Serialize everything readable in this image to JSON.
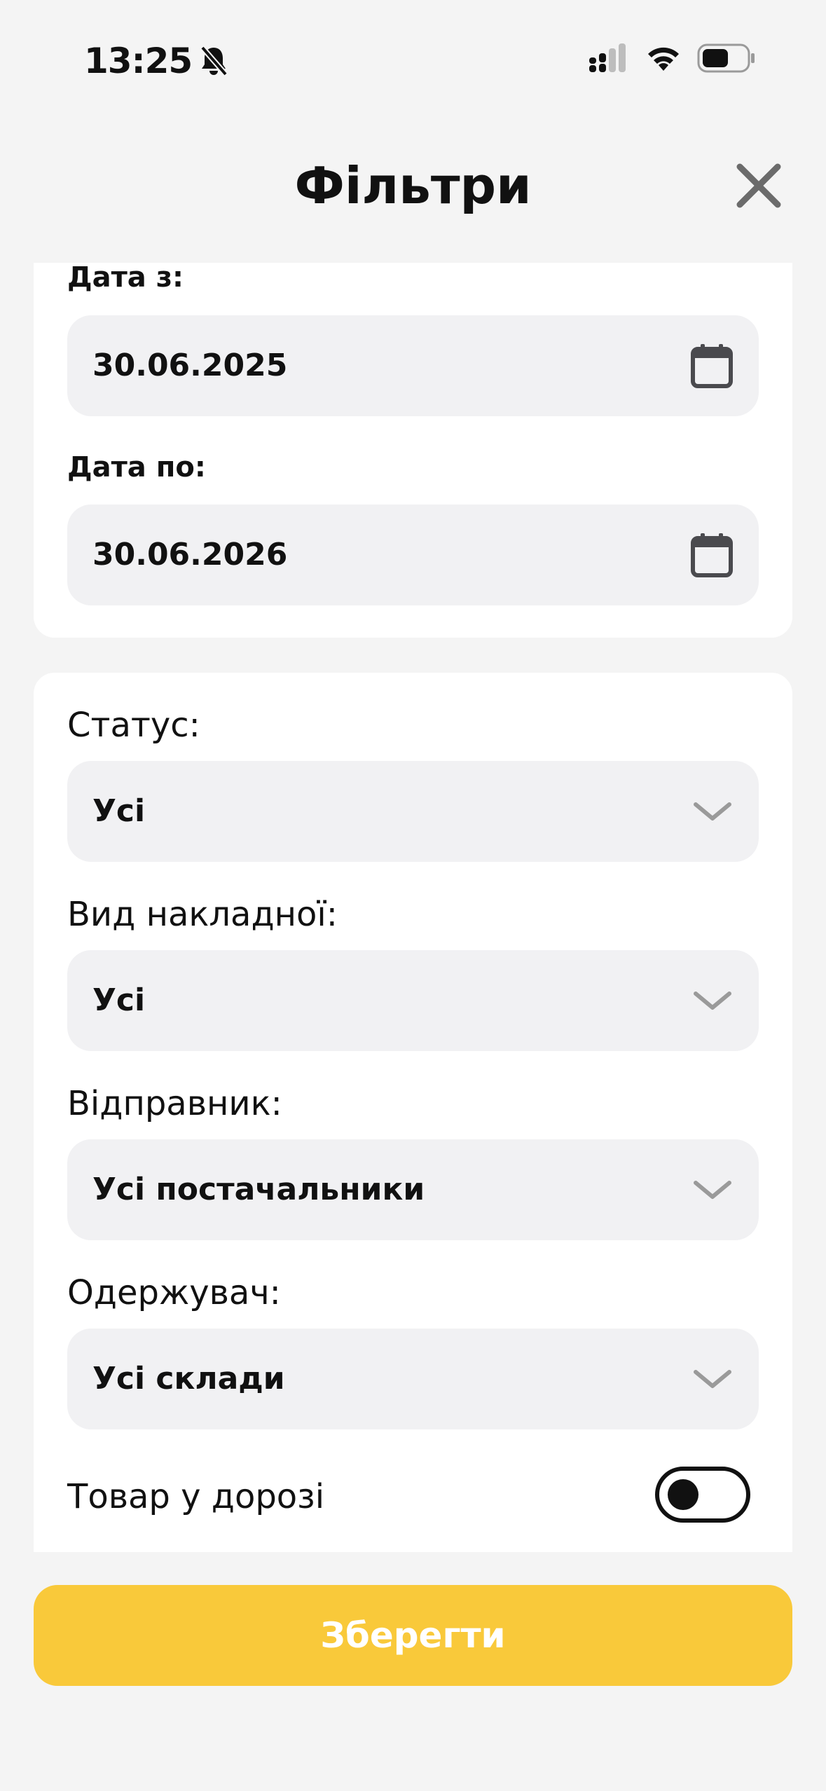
{
  "status_bar": {
    "time": "13:25",
    "icons": [
      "bell-slash-icon",
      "cellular-signal-icon",
      "wifi-icon",
      "battery-icon"
    ]
  },
  "header": {
    "title": "Фільтри",
    "close_icon": "close-icon"
  },
  "dates": {
    "from_label": "Дата з:",
    "from_value": "30.06.2025",
    "to_label": "Дата по:",
    "to_value": "30.06.2026",
    "icon": "calendar-icon"
  },
  "filters": {
    "status": {
      "label": "Статус:",
      "value": "Усі"
    },
    "invoice_type": {
      "label": "Вид накладної:",
      "value": "Усі"
    },
    "sender": {
      "label": "Відправник:",
      "value": "Усі постачальники"
    },
    "recipient": {
      "label": "Одержувач:",
      "value": "Усі склади"
    },
    "dropdown_icon": "chevron-down-icon"
  },
  "in_transit": {
    "label": "Товар у дорозі",
    "enabled": false
  },
  "save_button": {
    "label": "Зберегти"
  },
  "colors": {
    "background": "#f4f4f4",
    "card": "#ffffff",
    "field": "#f1f1f3",
    "accent": "#f9c93a",
    "text": "#111111",
    "chevron": "#9a9a9a",
    "close": "#6b6b6b"
  }
}
